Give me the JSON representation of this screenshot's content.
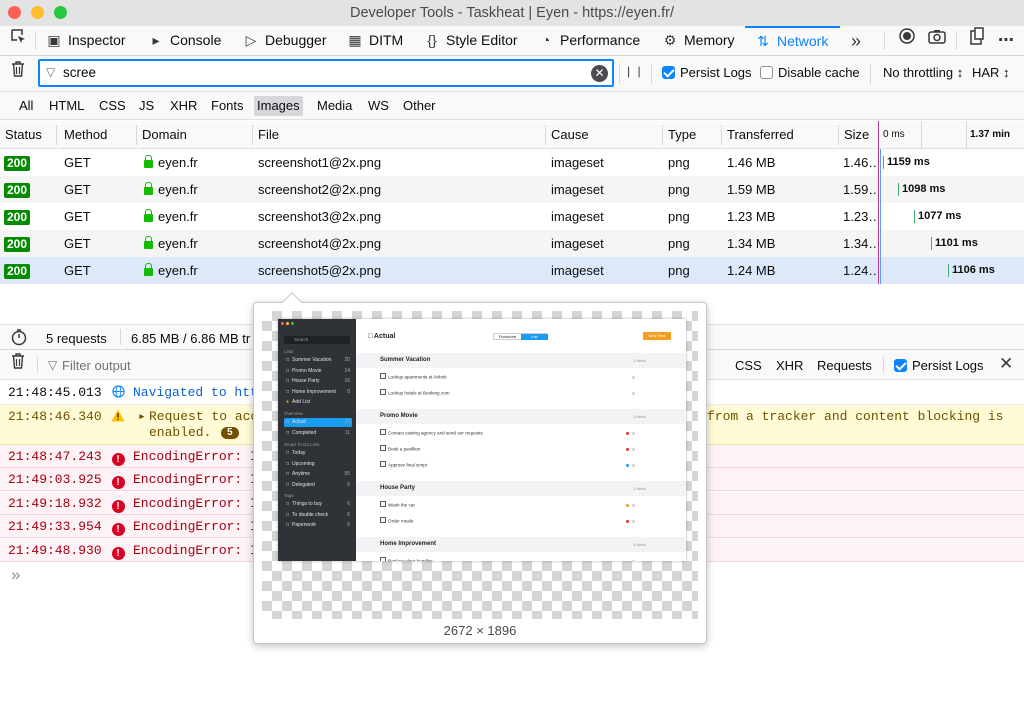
{
  "window": {
    "title": "Developer Tools - Taskheat | Eyen - https://eyen.fr/"
  },
  "toolbar": {
    "tabs": [
      {
        "label": "Inspector",
        "icon": "inspector-icon"
      },
      {
        "label": "Console",
        "icon": "console-icon"
      },
      {
        "label": "Debugger",
        "icon": "debugger-icon"
      },
      {
        "label": "DITM",
        "icon": "ditm-icon"
      },
      {
        "label": "Style Editor",
        "icon": "style-editor-icon"
      },
      {
        "label": "Performance",
        "icon": "performance-icon"
      },
      {
        "label": "Memory",
        "icon": "memory-icon"
      },
      {
        "label": "Network",
        "icon": "network-icon"
      }
    ],
    "selected_tab": "Network",
    "more_icon": "chevron-double-right-icon"
  },
  "network": {
    "filter": {
      "value": "scree",
      "placeholder": "Filter URLs"
    },
    "persist_logs": {
      "label": "Persist Logs",
      "checked": true
    },
    "disable_cache": {
      "label": "Disable cache",
      "checked": false
    },
    "throttling": "No throttling ↕",
    "har": "HAR ↕",
    "pause_label": "| |",
    "types": [
      "All",
      "HTML",
      "CSS",
      "JS",
      "XHR",
      "Fonts",
      "Images",
      "Media",
      "WS",
      "Other"
    ],
    "selected_type": "Images",
    "columns": {
      "status": "Status",
      "method": "Method",
      "domain": "Domain",
      "file": "File",
      "cause": "Cause",
      "type": "Type",
      "transferred": "Transferred",
      "size": "Size",
      "wf_start": "0 ms",
      "wf_end": "1.37 min"
    },
    "rows": [
      {
        "status": "200",
        "method": "GET",
        "domain": "eyen.fr",
        "file": "screenshot1@2x.png",
        "cause": "imageset",
        "type": "png",
        "transferred": "1.46 MB",
        "size": "1.46…",
        "time": "1159 ms"
      },
      {
        "status": "200",
        "method": "GET",
        "domain": "eyen.fr",
        "file": "screenshot2@2x.png",
        "cause": "imageset",
        "type": "png",
        "transferred": "1.59 MB",
        "size": "1.59…",
        "time": "1098 ms"
      },
      {
        "status": "200",
        "method": "GET",
        "domain": "eyen.fr",
        "file": "screenshot3@2x.png",
        "cause": "imageset",
        "type": "png",
        "transferred": "1.23 MB",
        "size": "1.23…",
        "time": "1077 ms"
      },
      {
        "status": "200",
        "method": "GET",
        "domain": "eyen.fr",
        "file": "screenshot4@2x.png",
        "cause": "imageset",
        "type": "png",
        "transferred": "1.34 MB",
        "size": "1.34…",
        "time": "1101 ms"
      },
      {
        "status": "200",
        "method": "GET",
        "domain": "eyen.fr",
        "file": "screenshot5@2x.png",
        "cause": "imageset",
        "type": "png",
        "transferred": "1.24 MB",
        "size": "1.24…",
        "time": "1106 ms"
      }
    ],
    "summary": {
      "requests": "5 requests",
      "sizes": "6.85 MB / 6.86 MB tr"
    }
  },
  "console": {
    "filter_placeholder": "Filter output",
    "buttons": [
      "CSS",
      "XHR",
      "Requests"
    ],
    "persist_logs": {
      "label": "Persist Logs",
      "checked": true
    },
    "messages": [
      {
        "time": "21:48:45.013",
        "kind": "info",
        "text": "Navigated to http"
      },
      {
        "time": "21:48:46.340",
        "kind": "warn",
        "text": "Request to acc",
        "text2": "enabled.",
        "tail": "from a tracker and content blocking is",
        "count": "5"
      },
      {
        "time": "21:48:47.243",
        "kind": "error",
        "text": "EncodingError: In"
      },
      {
        "time": "21:49:03.925",
        "kind": "error",
        "text": "EncodingError: In"
      },
      {
        "time": "21:49:18.932",
        "kind": "error",
        "text": "EncodingError: In"
      },
      {
        "time": "21:49:33.954",
        "kind": "error",
        "text": "EncodingError: In"
      },
      {
        "time": "21:49:48.930",
        "kind": "error",
        "text": "EncodingError: In"
      }
    ],
    "prompt": "»"
  },
  "preview": {
    "dimensions": "2672 × 1896",
    "app": {
      "search": "Search",
      "title": "Actual",
      "seg": [
        "Flowchart",
        "List"
      ],
      "new_task": "New Task",
      "lists_header": "Lists",
      "lists": [
        {
          "name": "Summer Vacation",
          "count": "20"
        },
        {
          "name": "Promo Movie",
          "count": "14"
        },
        {
          "name": "House Party",
          "count": "16"
        },
        {
          "name": "Home Improvement",
          "count": "8"
        }
      ],
      "add_list": "Add List",
      "overview_header": "Overview",
      "overview": [
        {
          "name": "Actual",
          "count": "13"
        },
        {
          "name": "Completed",
          "count": "11"
        }
      ],
      "smart_header": "Smart To Do Lists",
      "smart": [
        {
          "name": "Today",
          "count": ""
        },
        {
          "name": "Upcoming",
          "count": ""
        },
        {
          "name": "Anytime",
          "count": "55"
        },
        {
          "name": "Delegated",
          "count": "6"
        }
      ],
      "tags_header": "Tags",
      "tags": [
        {
          "name": "Things to buy",
          "count": "6"
        },
        {
          "name": "To double check",
          "count": "6"
        },
        {
          "name": "Paperwork",
          "count": "6"
        }
      ],
      "sections": [
        {
          "name": "Summer Vacation",
          "count": "2 tasks",
          "tasks": [
            "Lookup apartments at Airbnb",
            "Lookup hotels at Booking.com"
          ]
        },
        {
          "name": "Promo Movie",
          "count": "3 tasks",
          "tasks": [
            "Contact casting agency and send our requests",
            "Book a pavillion",
            "Approve final script"
          ]
        },
        {
          "name": "House Party",
          "count": "2 tasks",
          "tasks": [
            "Wash the car",
            "Order meals"
          ]
        },
        {
          "name": "Home Improvement",
          "count": "8 tasks",
          "tasks": [
            "Replace door handles"
          ]
        }
      ]
    }
  },
  "colors": {
    "accent": "#0a84ff",
    "status_ok": "#058b00",
    "secure": "#12bc00",
    "error_bg": "#fdf2f5",
    "warn_bg": "#fffbd6"
  }
}
